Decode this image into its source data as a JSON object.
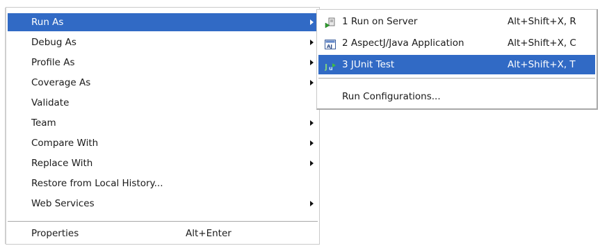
{
  "context_menu": {
    "items": [
      {
        "label": "Run As"
      },
      {
        "label": "Debug As"
      },
      {
        "label": "Profile As"
      },
      {
        "label": "Coverage As"
      },
      {
        "label": "Validate"
      },
      {
        "label": "Team"
      },
      {
        "label": "Compare With"
      },
      {
        "label": "Replace With"
      },
      {
        "label": "Restore from Local History..."
      },
      {
        "label": "Web Services"
      },
      {
        "label": "Properties",
        "shortcut": "Alt+Enter"
      }
    ]
  },
  "run_as_submenu": {
    "items": [
      {
        "label": "1 Run on Server",
        "shortcut": "Alt+Shift+X, R",
        "icon": "server-run-icon"
      },
      {
        "label": "2 AspectJ/Java Application",
        "shortcut": "Alt+Shift+X, C",
        "icon": "aspectj-icon"
      },
      {
        "label": "3 JUnit Test",
        "shortcut": "Alt+Shift+X, T",
        "icon": "junit-icon"
      },
      {
        "label": "Run Configurations..."
      }
    ]
  },
  "colors": {
    "selection": "#316ac5",
    "menu_background": "#ffffff"
  }
}
